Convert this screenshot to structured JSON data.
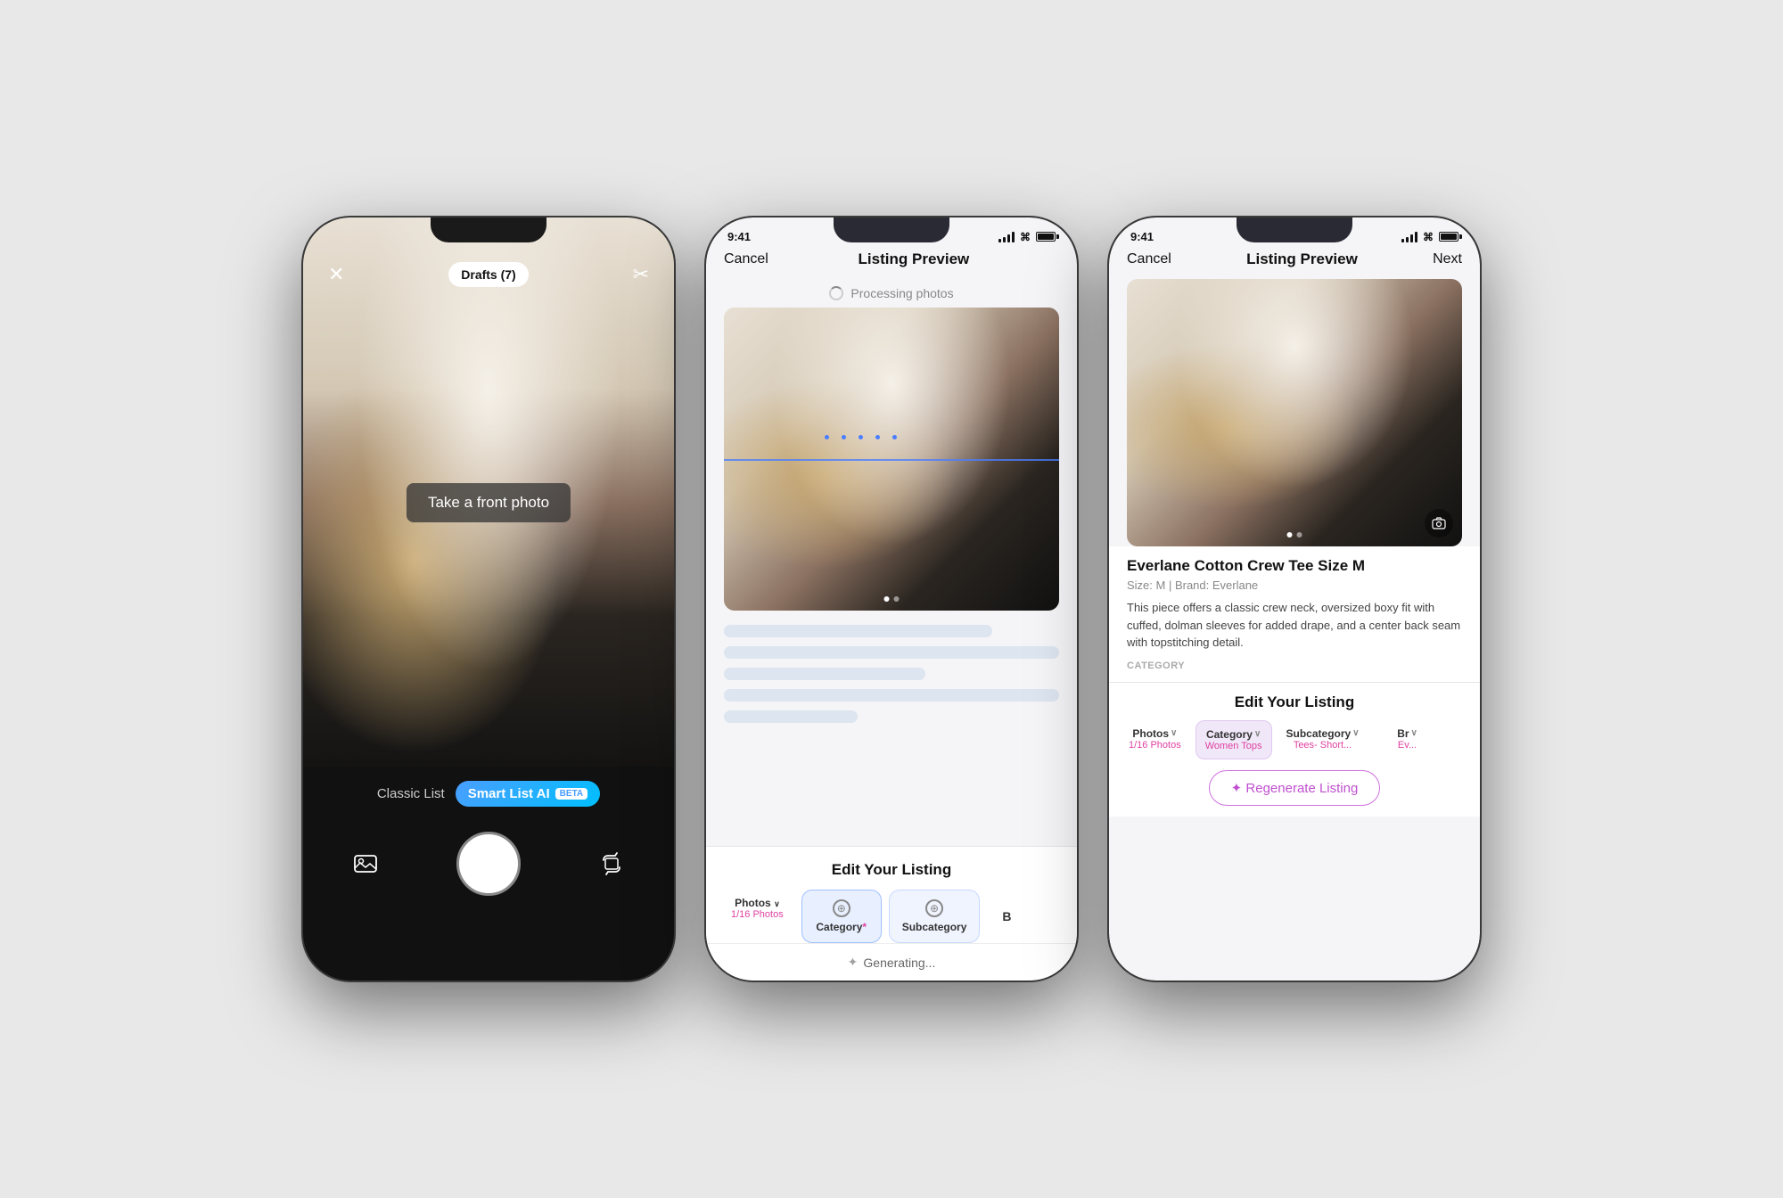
{
  "phone1": {
    "header": {
      "close_label": "✕",
      "drafts_label": "Drafts (7)",
      "scissors_label": "✂"
    },
    "camera": {
      "front_photo_text": "Take a front photo"
    },
    "modes": {
      "classic_label": "Classic List",
      "smart_label": "Smart List AI",
      "beta_label": "BETA"
    }
  },
  "phone2": {
    "status": {
      "time": "9:41",
      "signal": "signal",
      "wifi": "wifi",
      "battery": "battery"
    },
    "nav": {
      "cancel": "Cancel",
      "title": "Listing Preview",
      "next": ""
    },
    "processing": {
      "text": "Processing photos"
    },
    "edit": {
      "title": "Edit Your Listing",
      "tabs": [
        {
          "label": "Photos",
          "sublabel": "1/16 Photos",
          "icon": "chevron"
        },
        {
          "label": "Category",
          "sublabel": "*",
          "icon": "circle",
          "active": true
        },
        {
          "label": "Subcategory",
          "sublabel": "",
          "icon": "circle"
        },
        {
          "label": "B",
          "sublabel": "",
          "icon": ""
        }
      ]
    },
    "generating": {
      "text": "Generating..."
    }
  },
  "phone3": {
    "status": {
      "time": "9:41",
      "signal": "signal",
      "wifi": "wifi",
      "battery": "battery"
    },
    "nav": {
      "cancel": "Cancel",
      "title": "Listing Preview",
      "next": "Next"
    },
    "product": {
      "title": "Everlane Cotton Crew Tee Size M",
      "meta": "Size: M  |  Brand: Everlane",
      "description": "This piece offers a classic crew neck, oversized boxy fit with cuffed, dolman sleeves for added drape, and a center back seam with topstitching detail.",
      "category_label": "CATEGORY"
    },
    "edit": {
      "title": "Edit Your Listing",
      "tabs": [
        {
          "label": "Photos",
          "sublabel": "1/16 Photos"
        },
        {
          "label": "Category",
          "sublabel": "Women Tops",
          "chevron": "∨"
        },
        {
          "label": "Subcategory",
          "sublabel": "Tees- Short...",
          "chevron": "∨"
        },
        {
          "label": "Br",
          "sublabel": "Ev..."
        }
      ]
    },
    "regen": {
      "label": "✦ Regenerate Listing"
    }
  }
}
